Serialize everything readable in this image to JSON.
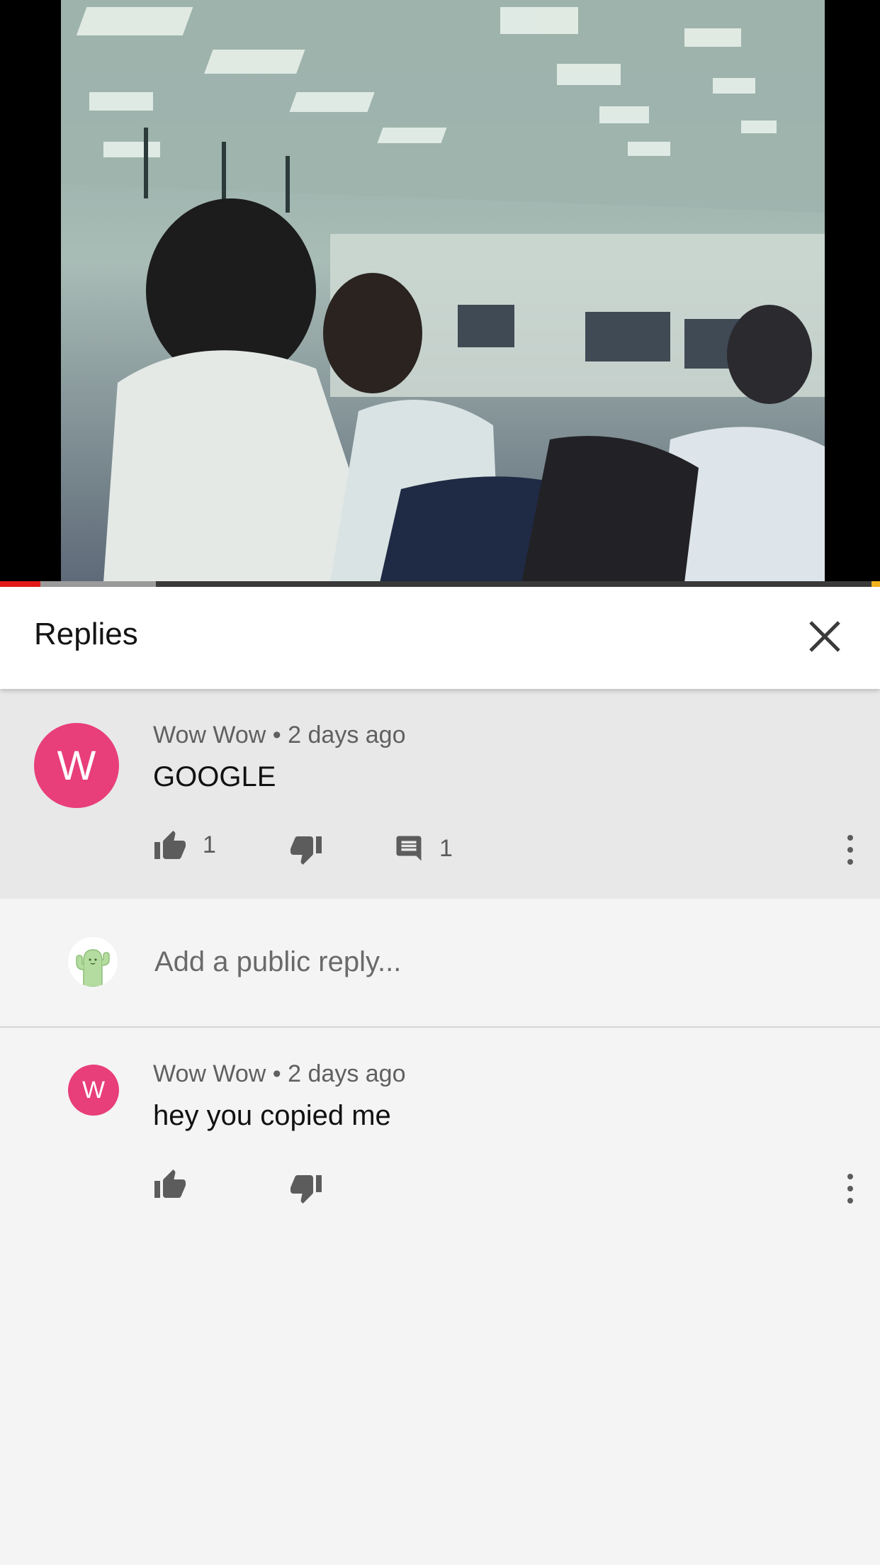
{
  "colors": {
    "accent_red": "#e3191a",
    "avatar_pink": "#e83e7a",
    "end_marker": "#f3b21b"
  },
  "video": {
    "played_fraction": 0.046,
    "buffered_fraction": 0.177
  },
  "header": {
    "title": "Replies",
    "close_icon": "close-icon"
  },
  "parent_comment": {
    "avatar_letter": "W",
    "author": "Wow Wow",
    "separator": "•",
    "time": "2 days ago",
    "text": "GOOGLE",
    "like_count": "1",
    "reply_count": "1",
    "icons": [
      "thumbs-up-icon",
      "thumbs-down-icon",
      "comment-icon",
      "more-vert-icon"
    ]
  },
  "reply_box": {
    "placeholder": "Add a public reply..."
  },
  "replies": [
    {
      "avatar_letter": "W",
      "author": "Wow Wow",
      "separator": "•",
      "time": "2 days ago",
      "text": "hey you copied me"
    }
  ]
}
